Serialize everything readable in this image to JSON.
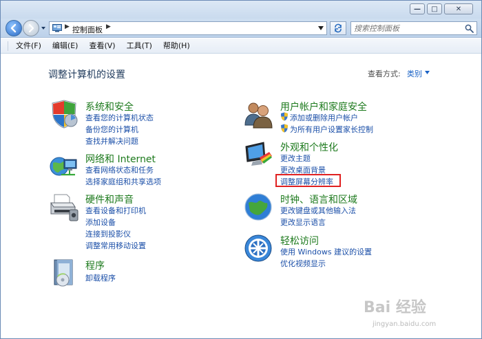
{
  "window": {
    "controls": {
      "minimize": "—",
      "maximize": "□",
      "close": "✕"
    }
  },
  "address_bar": {
    "breadcrumb": "控制面板",
    "search_placeholder": "搜索控制面板"
  },
  "menu": [
    "文件(F)",
    "编辑(E)",
    "查看(V)",
    "工具(T)",
    "帮助(H)"
  ],
  "content": {
    "title": "调整计算机的设置",
    "view_by_label": "查看方式:",
    "view_by_value": "类别"
  },
  "categories_left": [
    {
      "heading": "系统和安全",
      "icon": "shield-icon",
      "links": [
        "查看您的计算机状态",
        "备份您的计算机",
        "查找并解决问题"
      ]
    },
    {
      "heading": "网络和 Internet",
      "icon": "network-globe-icon",
      "links": [
        "查看网络状态和任务",
        "选择家庭组和共享选项"
      ]
    },
    {
      "heading": "硬件和声音",
      "icon": "printer-icon",
      "links": [
        "查看设备和打印机",
        "添加设备",
        "连接到投影仪",
        "调整常用移动设置"
      ]
    },
    {
      "heading": "程序",
      "icon": "programs-icon",
      "links": [
        "卸载程序"
      ]
    }
  ],
  "categories_right": [
    {
      "heading": "用户帐户和家庭安全",
      "icon": "users-icon",
      "links": [
        "添加或删除用户帐户",
        "为所有用户设置家长控制"
      ]
    },
    {
      "heading": "外观和个性化",
      "icon": "monitor-paint-icon",
      "links": [
        "更改主题",
        "更改桌面背景",
        "调整屏幕分辨率"
      ]
    },
    {
      "heading": "时钟、语言和区域",
      "icon": "clock-globe-icon",
      "links": [
        "更改键盘或其他输入法",
        "更改显示语言"
      ]
    },
    {
      "heading": "轻松访问",
      "icon": "ease-of-access-icon",
      "links": [
        "使用 Windows 建议的设置",
        "优化视频显示"
      ]
    }
  ],
  "watermark": {
    "logo": "Bai 经验",
    "url": "jingyan.baidu.com"
  },
  "colors": {
    "heading": "#1d7a1d",
    "link": "#1b4fa8",
    "title": "#1e395b",
    "highlight": "#e02020"
  }
}
